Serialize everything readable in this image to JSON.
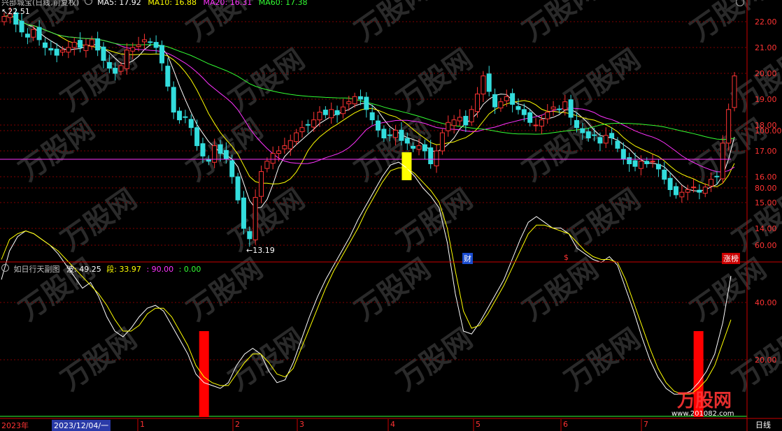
{
  "header": {
    "title": "兴部城宝(日线,前复权)",
    "ma": [
      {
        "label": "MA5: 17.92",
        "color": "#ffffff"
      },
      {
        "label": "MA10: 16.88",
        "color": "#ffff00"
      },
      {
        "label": "MA20: 16.31",
        "color": "#ff33ff"
      },
      {
        "label": "MA60: 17.38",
        "color": "#33ff33"
      }
    ]
  },
  "colors": {
    "up": "#ff3333",
    "down": "#33dddd",
    "grid": "#800000",
    "axis": "#cc0000"
  },
  "annotations": {
    "high": "22.51",
    "low": "13.19"
  },
  "markers": {
    "finance": "财",
    "dollar": "$",
    "limit": "涨榜"
  },
  "indicator": {
    "title": "如日行天副图",
    "items": [
      {
        "label": "波:",
        "value": "49.25",
        "color": "#ffffff"
      },
      {
        "label": "段:",
        "value": "33.97",
        "color": "#ffff00"
      },
      {
        "label": ":",
        "value": "90.00",
        "color": "#ff33ff"
      },
      {
        "label": ":",
        "value": "0.00",
        "color": "#33ff33"
      }
    ]
  },
  "axis_bottom": {
    "year": "2023年",
    "cursor_date": "2023/12/04/一",
    "months": [
      "1",
      "2",
      "3",
      "4",
      "5",
      "6",
      "7"
    ],
    "period": "日线"
  },
  "watermark": {
    "brand": "万股网",
    "url": "www.201082.com"
  },
  "chart_data": [
    {
      "type": "candlestick",
      "title": "兴部城宝(日线,前复权)",
      "ylim": [
        13.2,
        22.5
      ],
      "yticks": [
        "22.00",
        "21.00",
        "20.00",
        "19.00",
        "18.00",
        "17.00",
        "16.00",
        "15.00",
        "14.00"
      ],
      "close": [
        22.2,
        22.3,
        21.9,
        21.6,
        21.4,
        21.7,
        21.3,
        21.0,
        20.9,
        20.7,
        20.9,
        21.0,
        21.2,
        21.0,
        21.1,
        21.3,
        20.9,
        20.5,
        20.2,
        20.0,
        20.3,
        20.9,
        21.0,
        21.1,
        21.3,
        21.2,
        21.0,
        20.4,
        19.5,
        18.5,
        18.2,
        18.3,
        17.9,
        17.2,
        16.8,
        16.6,
        17.2,
        16.9,
        16.7,
        16.0,
        15.1,
        14.0,
        13.6,
        15.2,
        16.2,
        16.6,
        16.9,
        17.0,
        17.2,
        17.4,
        17.7,
        17.9,
        18.0,
        18.2,
        18.5,
        18.4,
        18.6,
        18.4,
        18.7,
        18.9,
        19.1,
        19.0,
        18.6,
        18.2,
        17.8,
        17.5,
        17.6,
        17.8,
        17.4,
        17.3,
        17.1,
        17.2,
        17.0,
        16.5,
        17.0,
        17.7,
        18.1,
        18.2,
        18.3,
        18.0,
        18.6,
        19.2,
        19.9,
        19.3,
        18.7,
        18.9,
        19.1,
        18.8,
        18.6,
        18.4,
        18.1,
        18.0,
        18.2,
        18.5,
        18.7,
        18.6,
        18.9,
        18.3,
        17.9,
        17.7,
        17.5,
        17.6,
        17.3,
        17.6,
        17.5,
        17.1,
        16.7,
        16.5,
        16.4,
        16.6,
        16.5,
        16.6,
        16.3,
        15.9,
        15.5,
        15.3,
        15.4,
        15.5,
        15.6,
        15.4,
        15.6,
        15.9,
        16.0,
        17.3,
        18.6,
        19.9
      ],
      "ma": {
        "MA5": 17.92,
        "MA10": 16.88,
        "MA20": 16.31,
        "MA60": 17.38
      }
    },
    {
      "type": "line",
      "title": "如日行天副图",
      "ylim": [
        0,
        110
      ],
      "yticks": [
        "100.00",
        "80.00",
        "60.00",
        "40.00",
        "20.00"
      ],
      "series": [
        {
          "name": "波",
          "values": [
            48,
            58,
            63,
            65,
            64,
            62,
            60,
            57,
            53,
            49,
            45,
            47,
            42,
            35,
            30,
            28,
            31,
            35,
            38,
            39,
            37,
            32,
            27,
            22,
            15,
            12,
            11,
            10,
            12,
            18,
            22,
            24,
            22,
            16,
            12,
            13,
            19,
            27,
            35,
            42,
            48,
            53,
            58,
            63,
            69,
            74,
            79,
            84,
            88,
            89,
            87,
            84,
            80,
            77,
            73,
            61,
            43,
            30,
            29,
            33,
            38,
            43,
            48,
            55,
            62,
            68,
            70,
            68,
            66,
            66,
            64,
            59,
            57,
            55,
            54,
            56,
            53,
            45,
            37,
            28,
            20,
            14,
            10,
            8,
            8,
            9,
            12,
            16,
            22,
            33,
            49.25
          ]
        },
        {
          "name": "段",
          "values": [
            55,
            62,
            64,
            65,
            64,
            62,
            60,
            58,
            55,
            52,
            49,
            46,
            43,
            39,
            34,
            30,
            30,
            32,
            36,
            38,
            38,
            35,
            30,
            25,
            18,
            14,
            12,
            11,
            11,
            15,
            19,
            22,
            22,
            19,
            15,
            14,
            17,
            24,
            31,
            38,
            45,
            51,
            56,
            61,
            66,
            72,
            77,
            82,
            86,
            87,
            87,
            85,
            82,
            79,
            75,
            66,
            51,
            37,
            31,
            32,
            36,
            41,
            46,
            52,
            58,
            64,
            67,
            67,
            66,
            65,
            64,
            61,
            58,
            56,
            55,
            55,
            54,
            48,
            40,
            32,
            24,
            17,
            12,
            9,
            8,
            8,
            10,
            13,
            18,
            26,
            33.97
          ]
        }
      ],
      "levels": [
        90.0,
        0.0
      ],
      "bars": [
        {
          "index": 25,
          "value": 30,
          "color": "#ff0000"
        },
        {
          "index": 50,
          "value": 90,
          "color": "#ffff00"
        },
        {
          "index": 86,
          "value": 30,
          "color": "#ff0000"
        }
      ]
    }
  ]
}
